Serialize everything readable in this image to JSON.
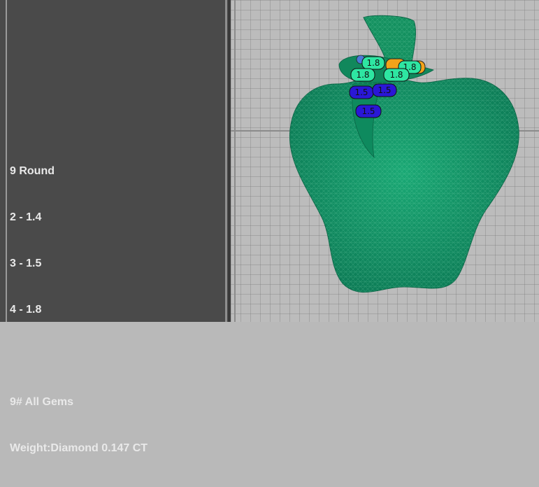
{
  "info": {
    "lines": [
      "9 Round",
      "2 - 1.4",
      "3 - 1.5",
      "4 - 1.8",
      "",
      "9# All Gems",
      "Weight:Diamond 0.147 CT"
    ]
  },
  "viewport": {
    "model": "apple-mesh",
    "model_color": "#11875f",
    "gems": [
      {
        "label": "1.8",
        "color": "#2ee6a2"
      },
      {
        "label": "1.8",
        "color": "#2ee6a2"
      },
      {
        "label": "1.8",
        "color": "#2ee6a2"
      },
      {
        "label": "1.8",
        "color": "#2ee6a2"
      },
      {
        "label": "1.5",
        "color": "#2a17d6"
      },
      {
        "label": "1.5",
        "color": "#2a17d6"
      },
      {
        "label": "1.5",
        "color": "#2a17d6"
      }
    ],
    "accent_orange": "#f2a31a"
  }
}
